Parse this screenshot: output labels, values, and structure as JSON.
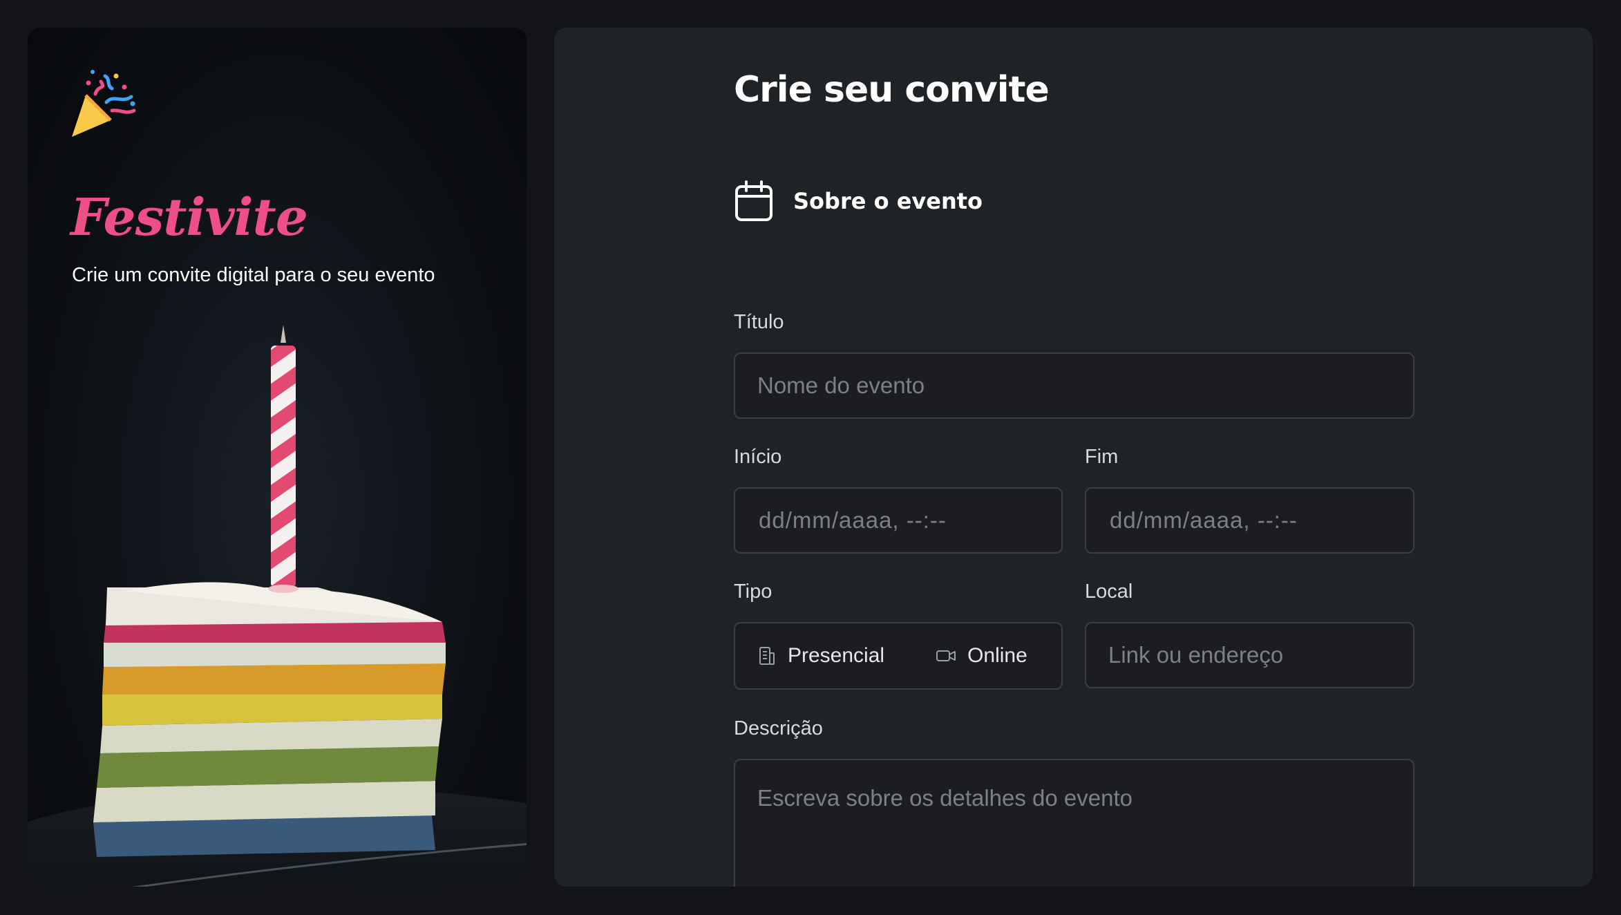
{
  "sidebar": {
    "brand": "Festivite",
    "tagline": "Crie um convite digital para o seu evento",
    "brand_color": "#ee4f86"
  },
  "form": {
    "title": "Crie seu convite",
    "section": {
      "icon": "calendar-icon",
      "label": "Sobre o evento"
    },
    "titulo": {
      "label": "Título",
      "placeholder": "Nome do evento"
    },
    "inicio": {
      "label": "Início",
      "placeholder": "dd/mm/aaaa, --:--"
    },
    "fim": {
      "label": "Fim",
      "placeholder": "dd/mm/aaaa, --:--"
    },
    "tipo": {
      "label": "Tipo",
      "options": [
        {
          "icon": "building-icon",
          "label": "Presencial"
        },
        {
          "icon": "video-camera-icon",
          "label": "Online"
        }
      ]
    },
    "local": {
      "label": "Local",
      "placeholder": "Link ou endereço"
    },
    "descricao": {
      "label": "Descrição",
      "placeholder": "Escreva sobre os detalhes do evento"
    }
  }
}
